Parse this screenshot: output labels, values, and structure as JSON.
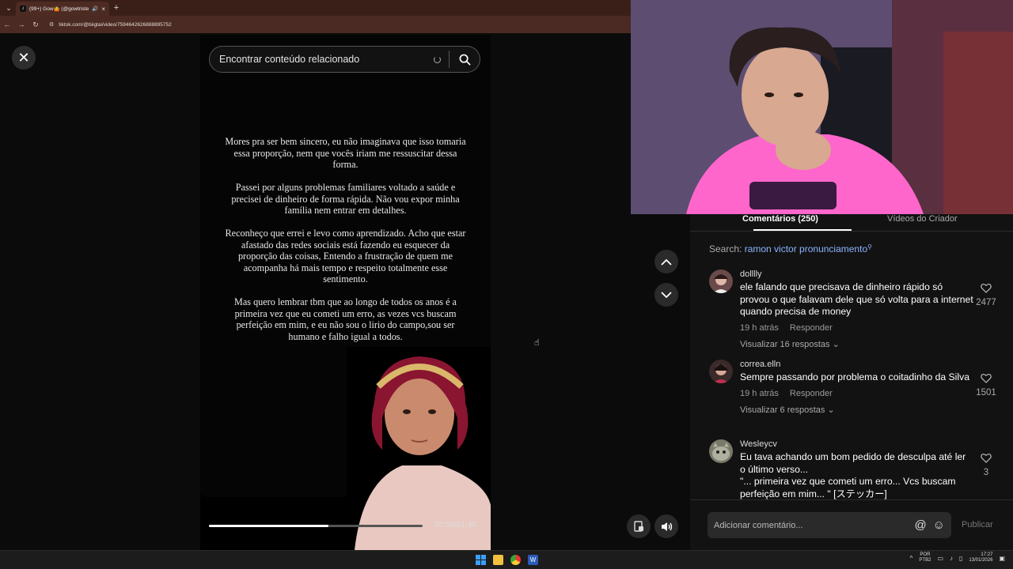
{
  "browser": {
    "tab_title": "(99+) Gow🤷 (@gowtriste_)",
    "url": "tiktok.com/@biigtai/video/7594642626888895752"
  },
  "search": {
    "placeholder": "Encontrar conteúdo relacionado"
  },
  "video": {
    "paragraphs": [
      "Mores pra ser bem sincero, eu não imaginava que isso tomaria essa proporção, nem que vocês iriam me ressuscitar dessa forma.",
      "Passei por alguns problemas familiares voltado a saúde e precisei de dinheiro de forma rápida. Não vou expor minha família nem entrar em detalhes.",
      "Reconheço que errei e levo como aprendizado. Acho que estar afastado das redes sociais está fazendo eu esquecer da proporção das coisas, Entendo a frustração de quem me acompanha há mais tempo e respeito totalmente esse sentimento.",
      "Mas quero lembrar tbm que ao longo de todos os anos é a primeira vez que eu cometi um erro, as vezes vcs buscam perfeição em mim, e eu não sou o lirio do campo,sou ser humano e falho igual a todos."
    ],
    "time": "00:56/01:40",
    "progress": 0.56
  },
  "comments_panel": {
    "tab_comments": "Comentários (250)",
    "tab_creator": "Vídeos do Criador",
    "search_prefix": "Search:",
    "search_query": "ramon victor pronunciamento",
    "add_placeholder": "Adicionar comentário...",
    "publish": "Publicar",
    "items": [
      {
        "user": "dolllly",
        "text": "ele falando que precisava de dinheiro rápido só provou o que falavam dele que só volta para a internet quando precisa de money",
        "time": "19 h atrás",
        "reply": "Responder",
        "replies": "Visualizar 16 respostas",
        "likes": "2477"
      },
      {
        "user": "correa.elln",
        "text": "Sempre passando por problema o coitadinho da Silva",
        "time": "19 h atrás",
        "reply": "Responder",
        "replies": "Visualizar 6 respostas",
        "likes": "1501"
      },
      {
        "user": "Wesleycv",
        "text": "Eu tava achando um bom pedido de desculpa até ler o último verso...",
        "text2": "\"... primeira vez que cometi um erro... Vcs buscam perfeição em mim... \" [ステッカー]",
        "likes": "3"
      }
    ]
  },
  "taskbar": {
    "lang_top": "POR",
    "lang_bottom": "PTB2",
    "time": "17:27",
    "date": "13/01/2026"
  }
}
